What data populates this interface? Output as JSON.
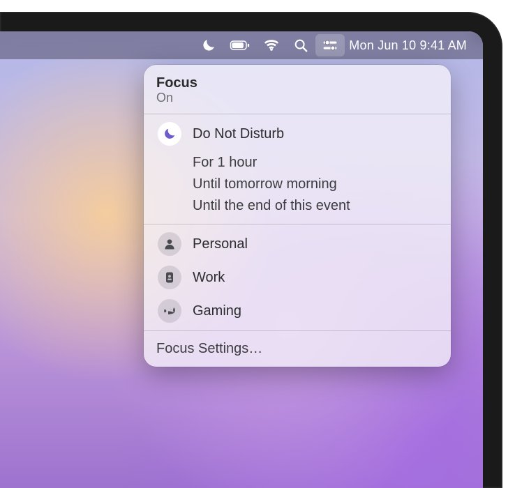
{
  "menubar": {
    "datetime": "Mon Jun 10  9:41 AM",
    "icons": {
      "focus": "moon-icon",
      "battery": "battery-icon",
      "wifi": "wifi-icon",
      "search": "search-icon",
      "control_center": "control-center-icon"
    }
  },
  "panel": {
    "title": "Focus",
    "status": "On",
    "active_mode": {
      "label": "Do Not Disturb",
      "icon": "moon-icon"
    },
    "duration_options": [
      "For 1 hour",
      "Until tomorrow morning",
      "Until the end of this event"
    ],
    "other_modes": [
      {
        "label": "Personal",
        "icon": "person-icon"
      },
      {
        "label": "Work",
        "icon": "badge-icon"
      },
      {
        "label": "Gaming",
        "icon": "rocket-icon"
      }
    ],
    "settings_label": "Focus Settings…"
  }
}
